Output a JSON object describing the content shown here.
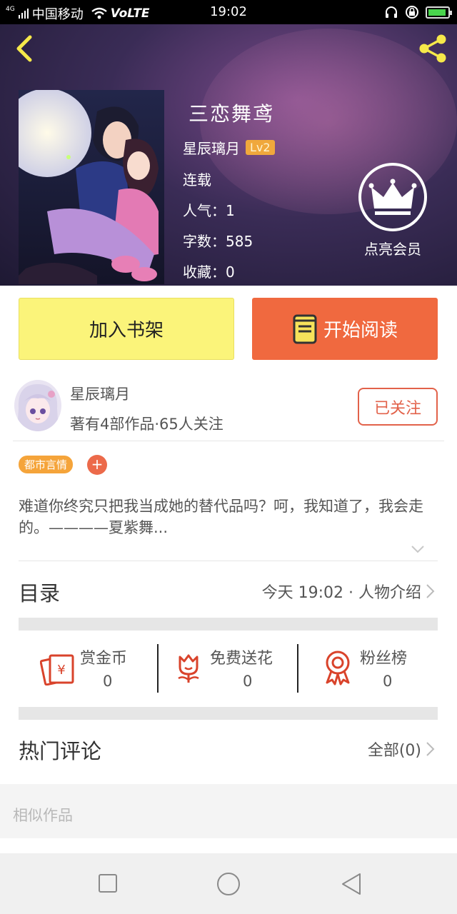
{
  "status_bar": {
    "network_tag": "4G",
    "carrier": "中国移动",
    "volte": "VoLTE",
    "time": "19:02"
  },
  "book": {
    "title": "三恋舞鸢",
    "author": "星辰璃月",
    "level": "Lv2",
    "status": "连载",
    "popularity": "人气：1",
    "word_count": "字数：585",
    "favorites": "收藏：0",
    "vip_label": "点亮会员"
  },
  "actions": {
    "add_shelf": "加入书架",
    "start_reading": "开始阅读"
  },
  "author_card": {
    "name": "星辰璃月",
    "stats": "著有4部作品·65人关注",
    "follow_state": "已关注"
  },
  "tags": {
    "genre": "都市言情",
    "add": "+"
  },
  "description": "难道你终究只把我当成她的替代品吗？呵，我知道了，我会走的。————夏紫舞...",
  "catalog": {
    "label": "目录",
    "latest": "今天 19:02 · 人物介绍"
  },
  "stats": [
    {
      "label": "赏金币",
      "value": "0",
      "icon": "red-envelope-icon"
    },
    {
      "label": "免费送花",
      "value": "0",
      "icon": "flower-icon"
    },
    {
      "label": "粉丝榜",
      "value": "0",
      "icon": "ribbon-medal-icon"
    }
  ],
  "comments": {
    "label": "热门评论",
    "all": "全部(0)"
  },
  "similar": {
    "label": "相似作品"
  },
  "colors": {
    "accent_orange": "#f0693f",
    "shelf_yellow": "#fbf47a",
    "tag_orange": "#f5a43a",
    "icon_red": "#d9432b"
  }
}
